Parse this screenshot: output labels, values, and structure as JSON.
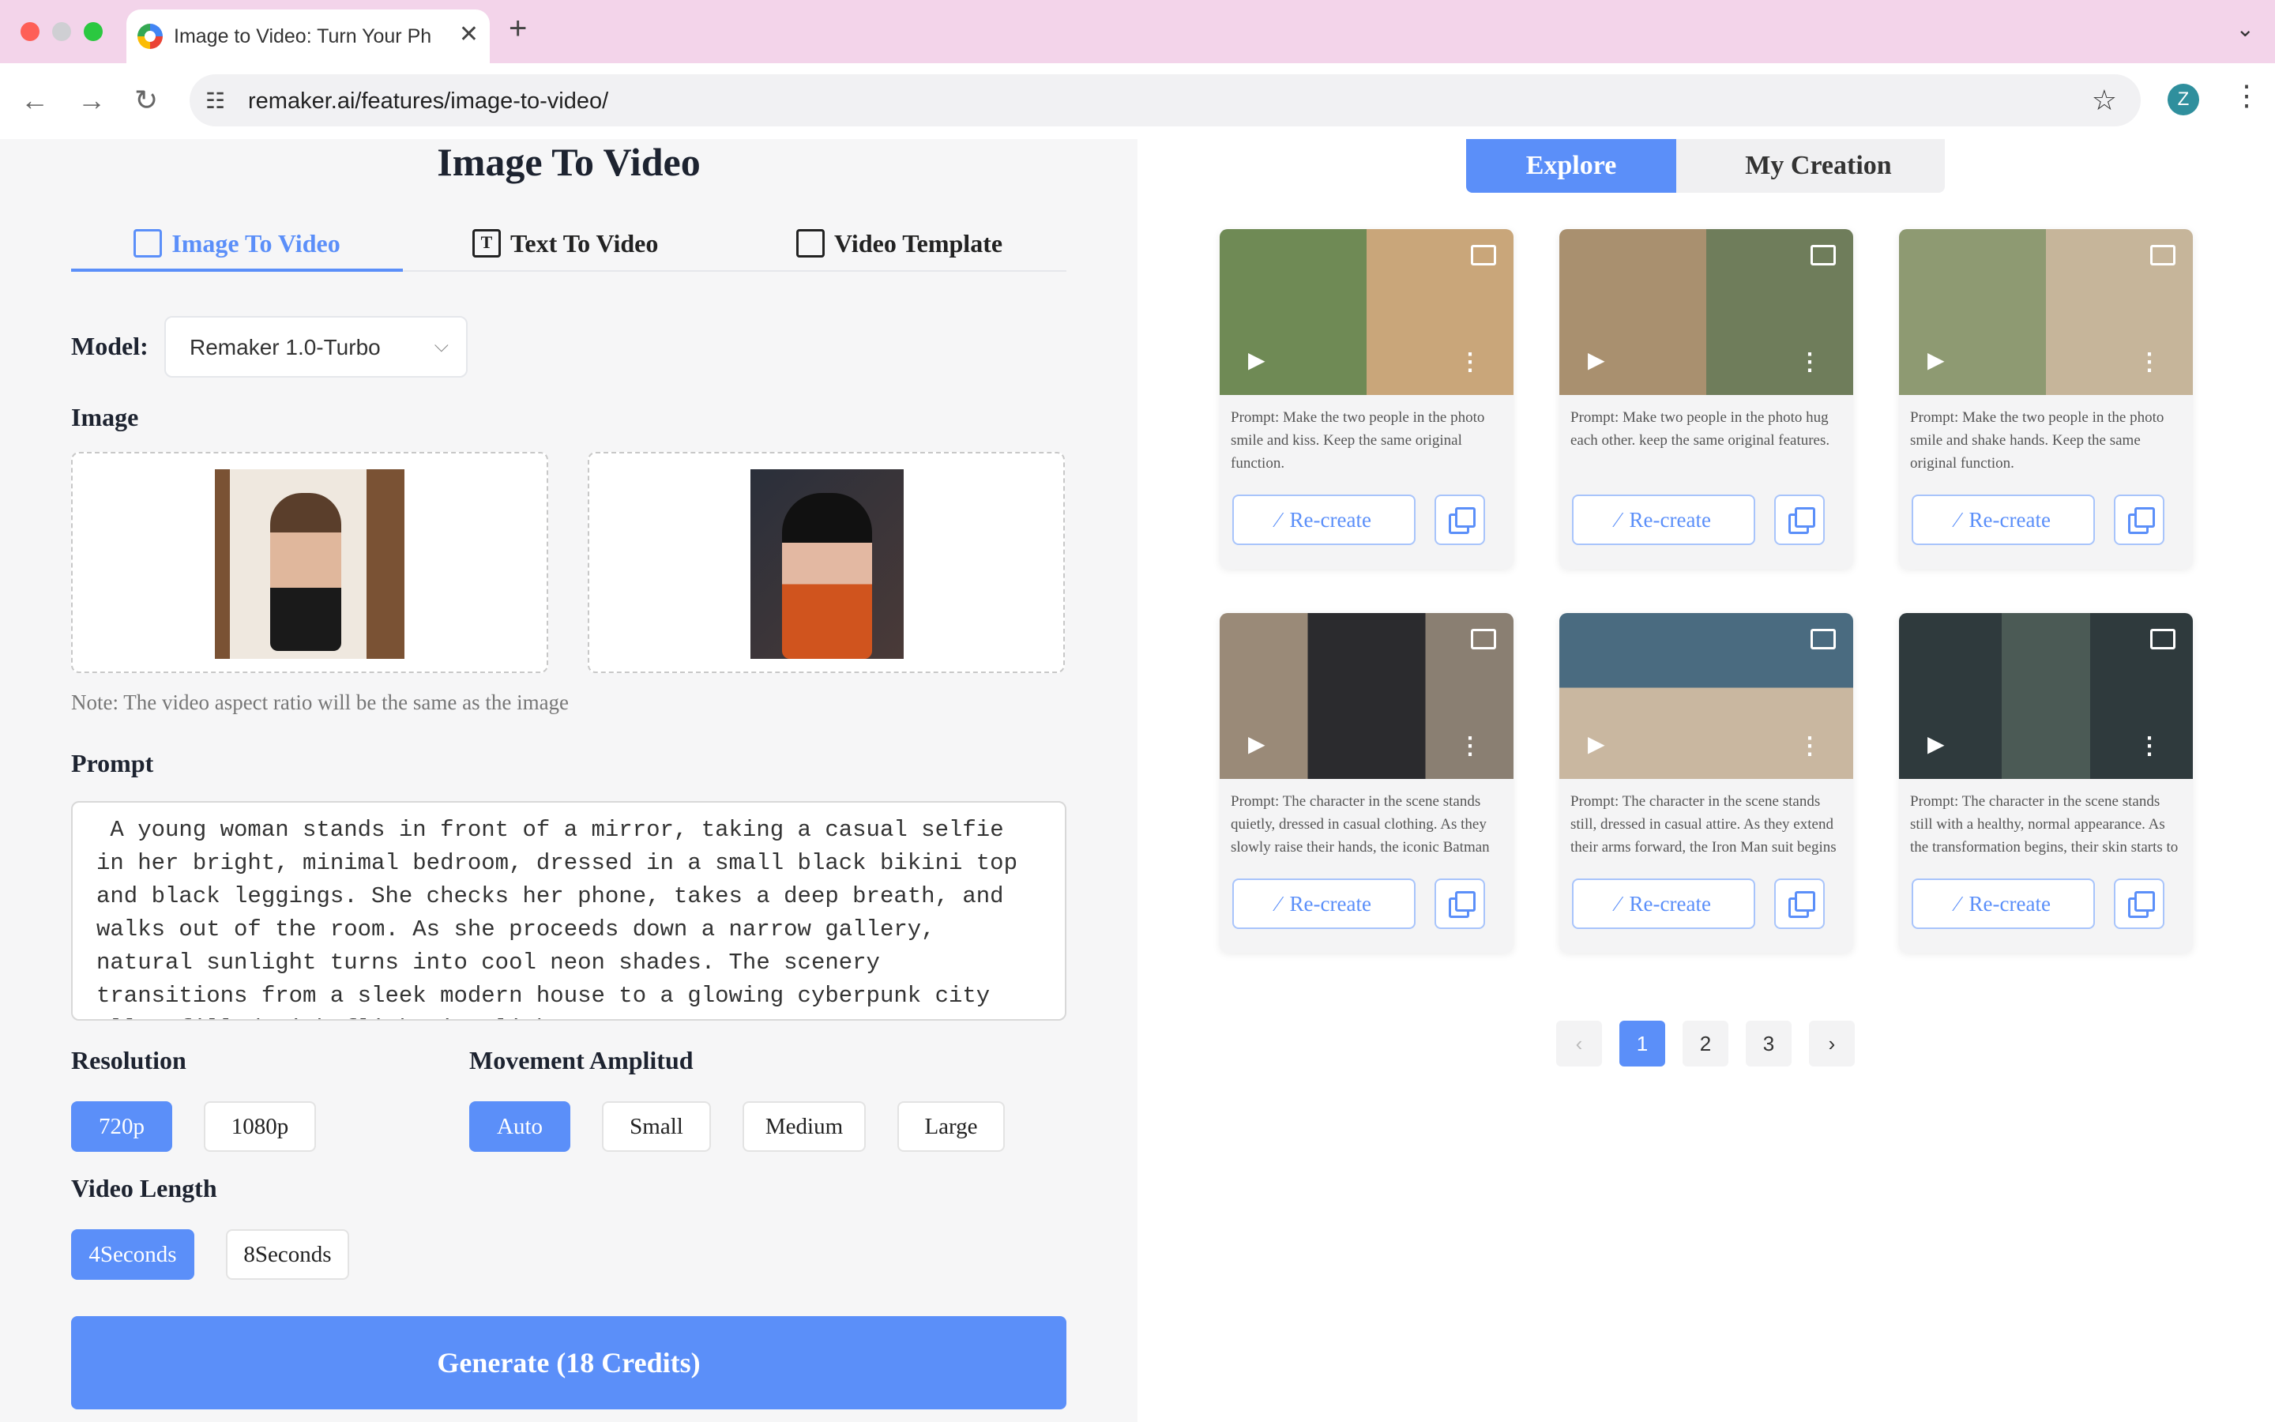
{
  "browser": {
    "tab_title": "Image to Video: Turn Your Photos",
    "url": "remaker.ai/features/image-to-video/",
    "profile_initial": "Z",
    "new_tab": "+",
    "close": "✕"
  },
  "left": {
    "title": "Image To Video",
    "tabs": [
      {
        "label": "Image To Video"
      },
      {
        "label": "Text To Video"
      },
      {
        "label": "Video Template"
      }
    ],
    "model_label": "Model:",
    "model_value": "Remaker 1.0-Turbo",
    "image_label": "Image",
    "note": "Note: The video aspect ratio will be the same as the image",
    "prompt_label": "Prompt",
    "prompt_text": " A young woman stands in front of a mirror, taking a casual selfie in her bright, minimal bedroom, dressed in a small black bikini top and black leggings. She checks her phone, takes a deep breath, and walks out of the room. As she proceeds down a narrow gallery, natural sunlight turns into cool neon shades. The scenery transitions from a sleek modern house to a glowing cyberpunk city alley filled with flickering lights",
    "resolution_label": "Resolution",
    "resolutions": [
      "720p",
      "1080p"
    ],
    "movement_label": "Movement Amplitud",
    "movements": [
      "Auto",
      "Small",
      "Medium",
      "Large"
    ],
    "length_label": "Video Length",
    "lengths": [
      "4Seconds",
      "8Seconds"
    ],
    "generate_label": "Generate (18 Credits)"
  },
  "right": {
    "tabs": [
      "Explore",
      "My Creation"
    ],
    "recreate_label": "Re-create",
    "cards": [
      {
        "prompt": "Prompt: Make the two people in the photo smile and kiss. Keep the same original function."
      },
      {
        "prompt": "Prompt: Make two people in the photo hug each other. keep the same original features."
      },
      {
        "prompt": "Prompt: Make the two people in the photo smile and shake hands. Keep the same original function."
      },
      {
        "prompt": "Prompt: The character in the scene stands quietly, dressed in casual clothing. As they slowly raise their hands, the iconic Batman costume begins to form around…"
      },
      {
        "prompt": "Prompt: The character in the scene stands still, dressed in casual attire. As they extend their arms forward, the Iron Man suit begins to materialize around them.…"
      },
      {
        "prompt": "Prompt: The character in the scene stands still with a healthy, normal appearance. As the transformation begins, their skin starts to pale, and veins appear dark and…"
      }
    ],
    "pagination": {
      "prev": "‹",
      "pages": [
        "1",
        "2",
        "3"
      ],
      "next": "›",
      "current": "1"
    }
  },
  "colors": {
    "accent": "#5b8ff9",
    "tabbar": "#f3d4ea"
  }
}
